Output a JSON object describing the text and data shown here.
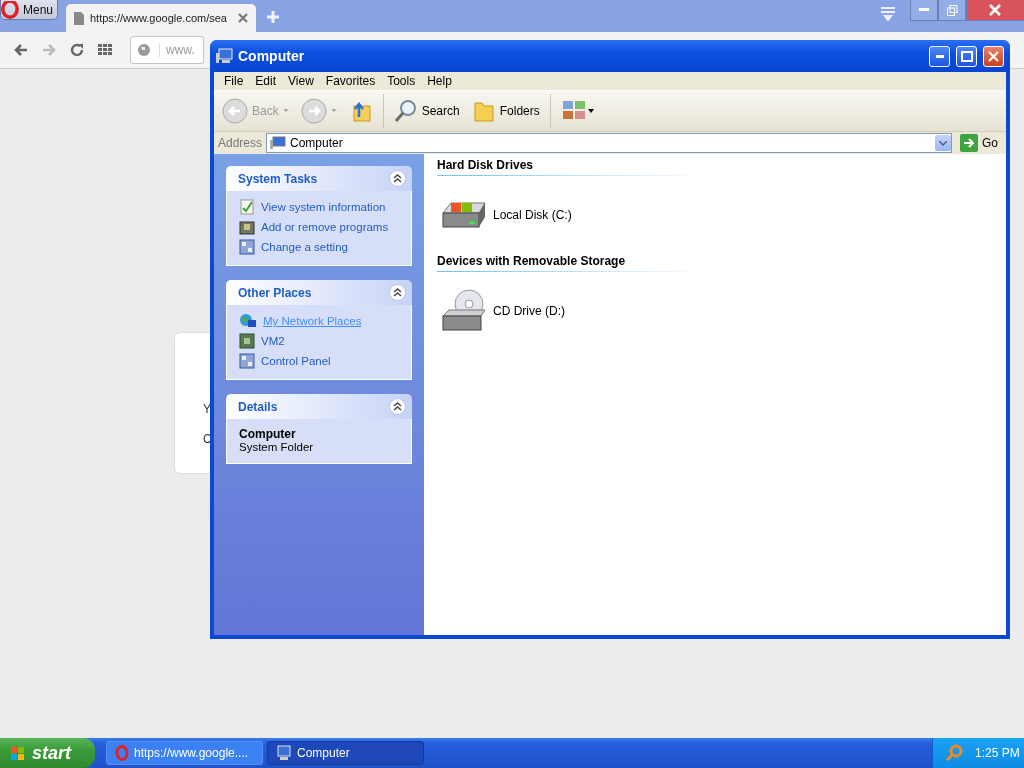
{
  "browser": {
    "menu_label": "Menu",
    "tabs": [
      {
        "title": "https://www.google.com/sea",
        "selected": true
      }
    ],
    "address": "www.",
    "page_card": {
      "lines": [
        "Y",
        "C"
      ]
    }
  },
  "explorer": {
    "title": "Computer",
    "menu": [
      "File",
      "Edit",
      "View",
      "Favorites",
      "Tools",
      "Help"
    ],
    "toolbar": [
      {
        "kind": "back",
        "label": "Back",
        "disabled": true
      },
      {
        "kind": "forward",
        "disabled": true
      },
      {
        "kind": "up"
      },
      {
        "kind": "search",
        "label": "Search"
      },
      {
        "kind": "folders",
        "label": "Folders"
      },
      {
        "kind": "views"
      }
    ],
    "address": {
      "label": "Address",
      "value": "Computer",
      "go": "Go"
    },
    "panels": [
      {
        "kind": "links",
        "title": "System Tasks",
        "expanded": true,
        "items": [
          {
            "kind": "info",
            "label": "View system information",
            "hovered": false
          },
          {
            "kind": "programs",
            "label": "Add or remove programs",
            "hovered": false
          },
          {
            "kind": "panel",
            "label": "Change a setting",
            "hovered": false
          }
        ]
      },
      {
        "kind": "links",
        "title": "Other Places",
        "expanded": true,
        "items": [
          {
            "kind": "network",
            "label": "My Network Places",
            "hovered": true
          },
          {
            "kind": "vm",
            "label": "VM2",
            "hovered": false
          },
          {
            "kind": "panel",
            "label": "Control Panel",
            "hovered": false
          }
        ]
      },
      {
        "kind": "details",
        "title": "Details",
        "expanded": true,
        "name": "Computer",
        "description": "System Folder"
      }
    ],
    "groups": [
      {
        "title": "Hard Disk Drives",
        "items": [
          {
            "kind": "disk",
            "label": "Local Disk (C:)"
          }
        ]
      },
      {
        "title": "Devices with Removable Storage",
        "items": [
          {
            "kind": "cd",
            "label": "CD Drive (D:)"
          }
        ]
      }
    ]
  },
  "taskbar": {
    "start": "start",
    "tasks": [
      {
        "kind": "browser",
        "label": "https://www.google....",
        "selected": false
      },
      {
        "kind": "computer",
        "label": "Computer",
        "selected": true
      }
    ],
    "clock": "1:25 PM"
  }
}
